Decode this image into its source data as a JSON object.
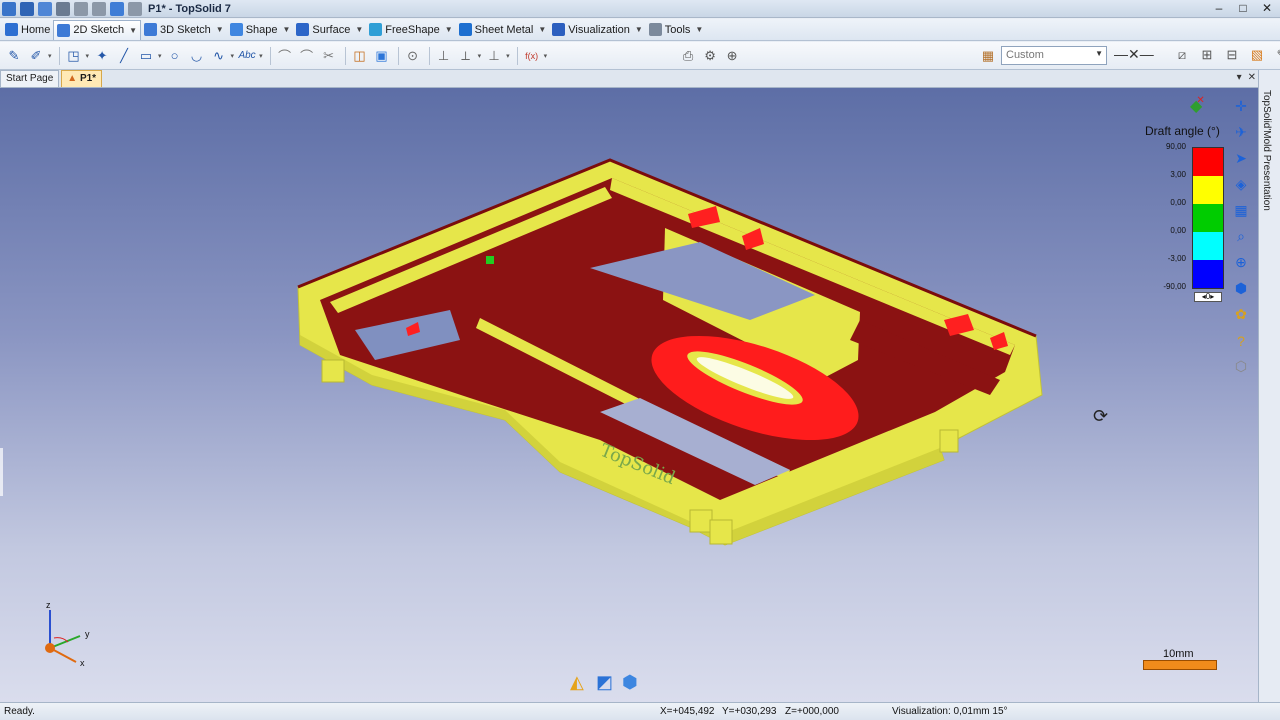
{
  "window": {
    "title": "P1* - TopSolid 7",
    "controls": [
      "–",
      "□",
      "✕"
    ]
  },
  "ribbon_tabs": [
    {
      "label": "Home",
      "color": "#2d6fd1",
      "dropdown": false
    },
    {
      "label": "2D Sketch",
      "color": "#3d7ad6",
      "dropdown": true
    },
    {
      "label": "3D Sketch",
      "color": "#3d7ad6",
      "dropdown": true
    },
    {
      "label": "Shape",
      "color": "#3f86e0",
      "dropdown": true
    },
    {
      "label": "Surface",
      "color": "#2d66c8",
      "dropdown": true
    },
    {
      "label": "FreeShape",
      "color": "#2f9fd6",
      "dropdown": true
    },
    {
      "label": "Sheet Metal",
      "color": "#1d6fd0",
      "dropdown": true
    },
    {
      "label": "Visualization",
      "color": "#2c5fbf",
      "dropdown": true
    },
    {
      "label": "Tools",
      "color": "#7c8a9c",
      "dropdown": true
    }
  ],
  "toolbar": {
    "style_select": {
      "value": "Custom"
    },
    "icons": [
      "pencil-icon",
      "multi-pencil-icon",
      "rectangle-sketch-icon",
      "point-icon",
      "line-icon",
      "rectangle-icon",
      "circle-icon",
      "arc-icon",
      "spline-icon",
      "text-icon",
      "fillet-icon",
      "chamfer-icon",
      "trim-icon",
      "offset-icon",
      "project-icon",
      "measure-icon",
      "constraint-icon",
      "dimension-icon",
      "formula-icon",
      "camera-icon",
      "zoom-icon"
    ],
    "text_icon_label": "Abc",
    "formula_label": "f(x)"
  },
  "doc_tabs": [
    {
      "label": "Start Page",
      "active": false
    },
    {
      "label": "P1*",
      "active": true
    }
  ],
  "side_panel": {
    "label": "TopSolid'Mold Presentation"
  },
  "legend": {
    "title": "Draft angle (°)",
    "values": [
      "90,00",
      "3,00",
      "0,00",
      "0,00",
      "-3,00",
      "-90,00"
    ],
    "colors": [
      "#ff0000",
      "#ffff00",
      "#00cc00",
      "#00ffff",
      "#0000ff"
    ],
    "control_value": "0"
  },
  "model": {
    "engraving": "TopSolid",
    "main_color": "#e8e84a",
    "face_color": "#8b1010",
    "highlight_color": "#ff1a1a"
  },
  "axis": {
    "x": "x",
    "y": "y",
    "z": "z"
  },
  "scale": {
    "label": "10mm"
  },
  "status": {
    "message": "Ready.",
    "x": "X=+045,492",
    "y": "Y=+030,293",
    "z": "Z=+000,000",
    "visualization": "Visualization: 0,01mm 15°"
  }
}
